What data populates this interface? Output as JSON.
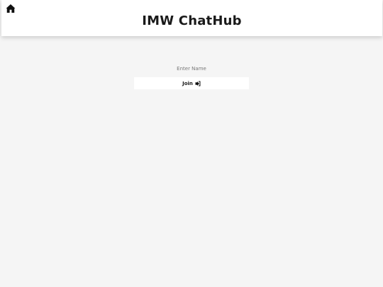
{
  "header": {
    "title": "IMW ChatHub",
    "home_icon": "home-icon"
  },
  "join_form": {
    "name_placeholder": "Enter Name",
    "name_value": "",
    "join_label": "Join",
    "join_icon": "sign-in-icon"
  },
  "colors": {
    "background": "#f5f5f5",
    "header_background": "#ffffff",
    "text": "#1a1a1a"
  }
}
